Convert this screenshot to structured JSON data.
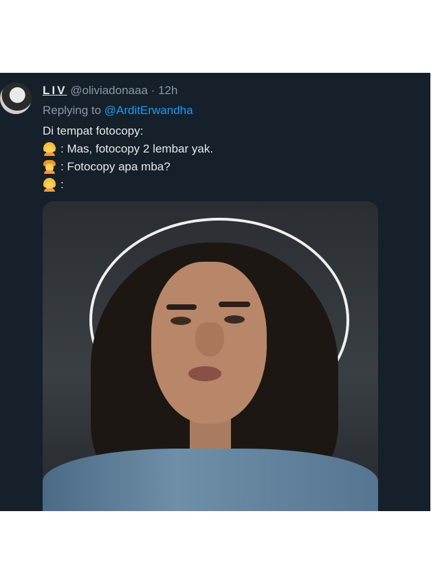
{
  "tweet": {
    "display_name": "LIV",
    "handle": "@oliviadonaaa",
    "separator": "·",
    "time": "12h",
    "replying_prefix": "Replying to",
    "replying_to": "@ArditErwandha",
    "lines": [
      {
        "emoji": "",
        "text": "Di tempat fotocopy:"
      },
      {
        "emoji": "woman-icon",
        "text": ": Mas, fotocopy 2 lembar yak."
      },
      {
        "emoji": "boy-icon",
        "text": ": Fotocopy apa mba?"
      },
      {
        "emoji": "woman-icon",
        "text": ":"
      }
    ]
  },
  "colors": {
    "card_bg": "#15202b",
    "text_primary": "#e7e9ea",
    "text_secondary": "#8b98a5",
    "link": "#1d9bf0"
  }
}
